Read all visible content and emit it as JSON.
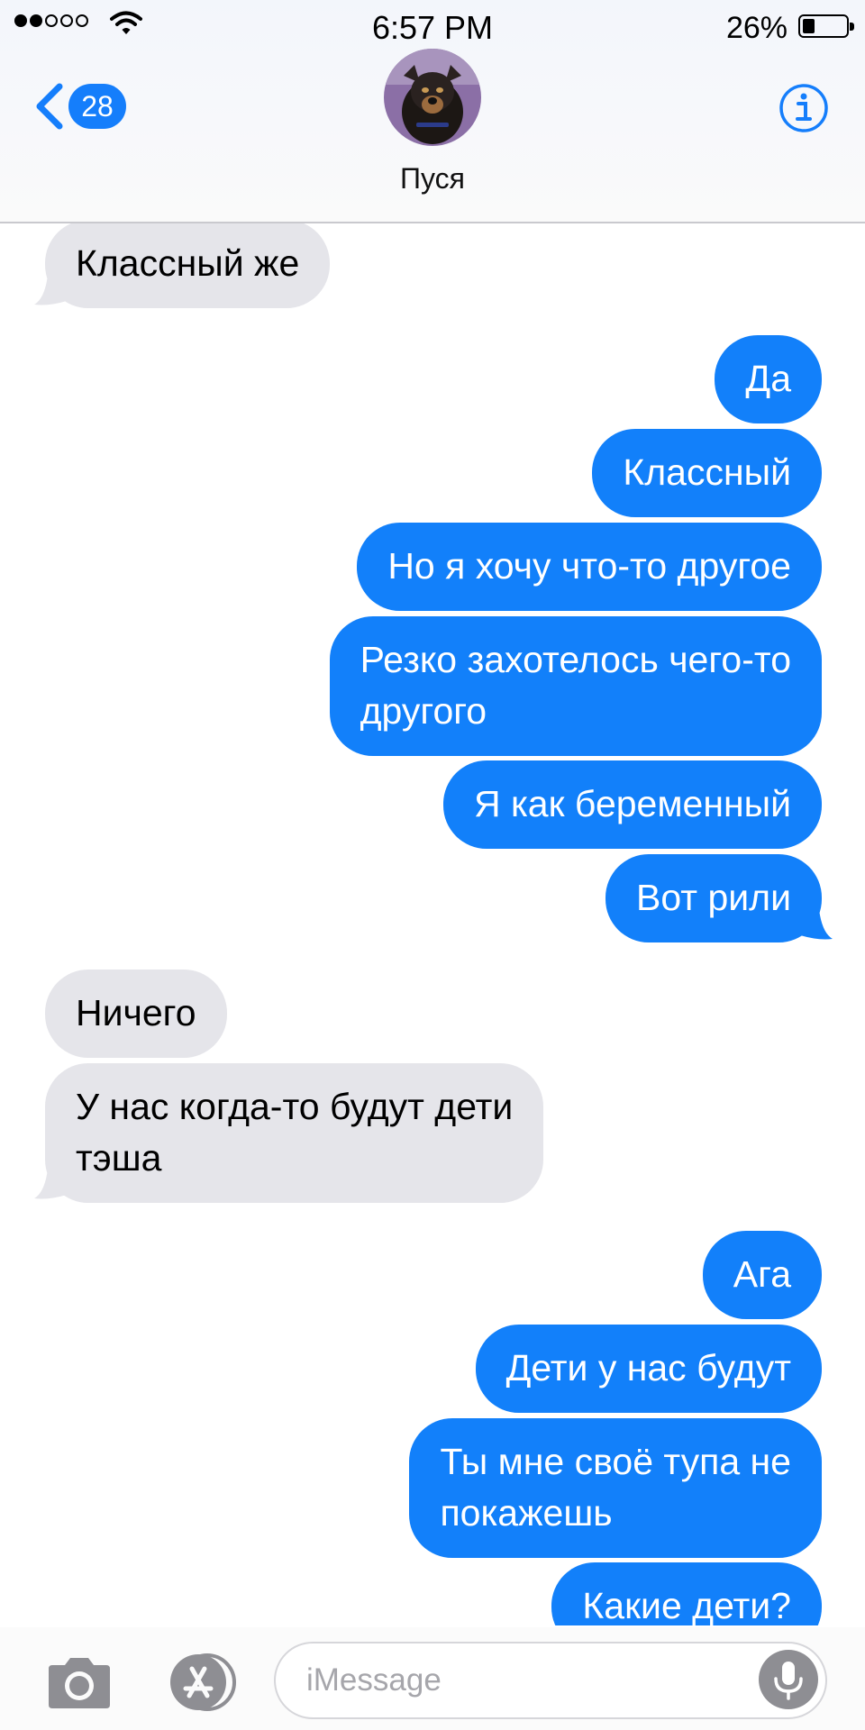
{
  "status_bar": {
    "time": "6:57 PM",
    "battery_percent": "26%",
    "signal_bars_filled": 2,
    "signal_bars_total": 5,
    "battery_level": 0.26
  },
  "header": {
    "back_count": "28",
    "contact_name": "Пуся"
  },
  "messages": [
    {
      "direction": "received",
      "text": "Классный же"
    },
    {
      "direction": "sent",
      "text": "Да"
    },
    {
      "direction": "sent",
      "text": "Классный"
    },
    {
      "direction": "sent",
      "text": "Но я хочу что-то другое"
    },
    {
      "direction": "sent",
      "text": "Резко захотелось чего-то\nдругого"
    },
    {
      "direction": "sent",
      "text": "Я как беременный"
    },
    {
      "direction": "sent",
      "text": "Вот рили"
    },
    {
      "direction": "received",
      "text": "Ничего"
    },
    {
      "direction": "received",
      "text": "У нас когда-то будут дети\nтэша"
    },
    {
      "direction": "sent",
      "text": "Ага"
    },
    {
      "direction": "sent",
      "text": "Дети у нас будут"
    },
    {
      "direction": "sent",
      "text": "Ты мне своё тупа не\nпокажешь"
    },
    {
      "direction": "sent",
      "text": "Какие дети?"
    }
  ],
  "input": {
    "placeholder": "iMessage"
  },
  "colors": {
    "accent": "#157efb",
    "sent_bubble": "#1280fa",
    "received_bubble": "#e5e5ea"
  },
  "icons": {
    "back": "chevron-left-icon",
    "info": "info-icon",
    "camera": "camera-icon",
    "apps": "app-store-icon",
    "mic": "microphone-icon",
    "wifi": "wifi-icon",
    "battery": "battery-icon"
  }
}
